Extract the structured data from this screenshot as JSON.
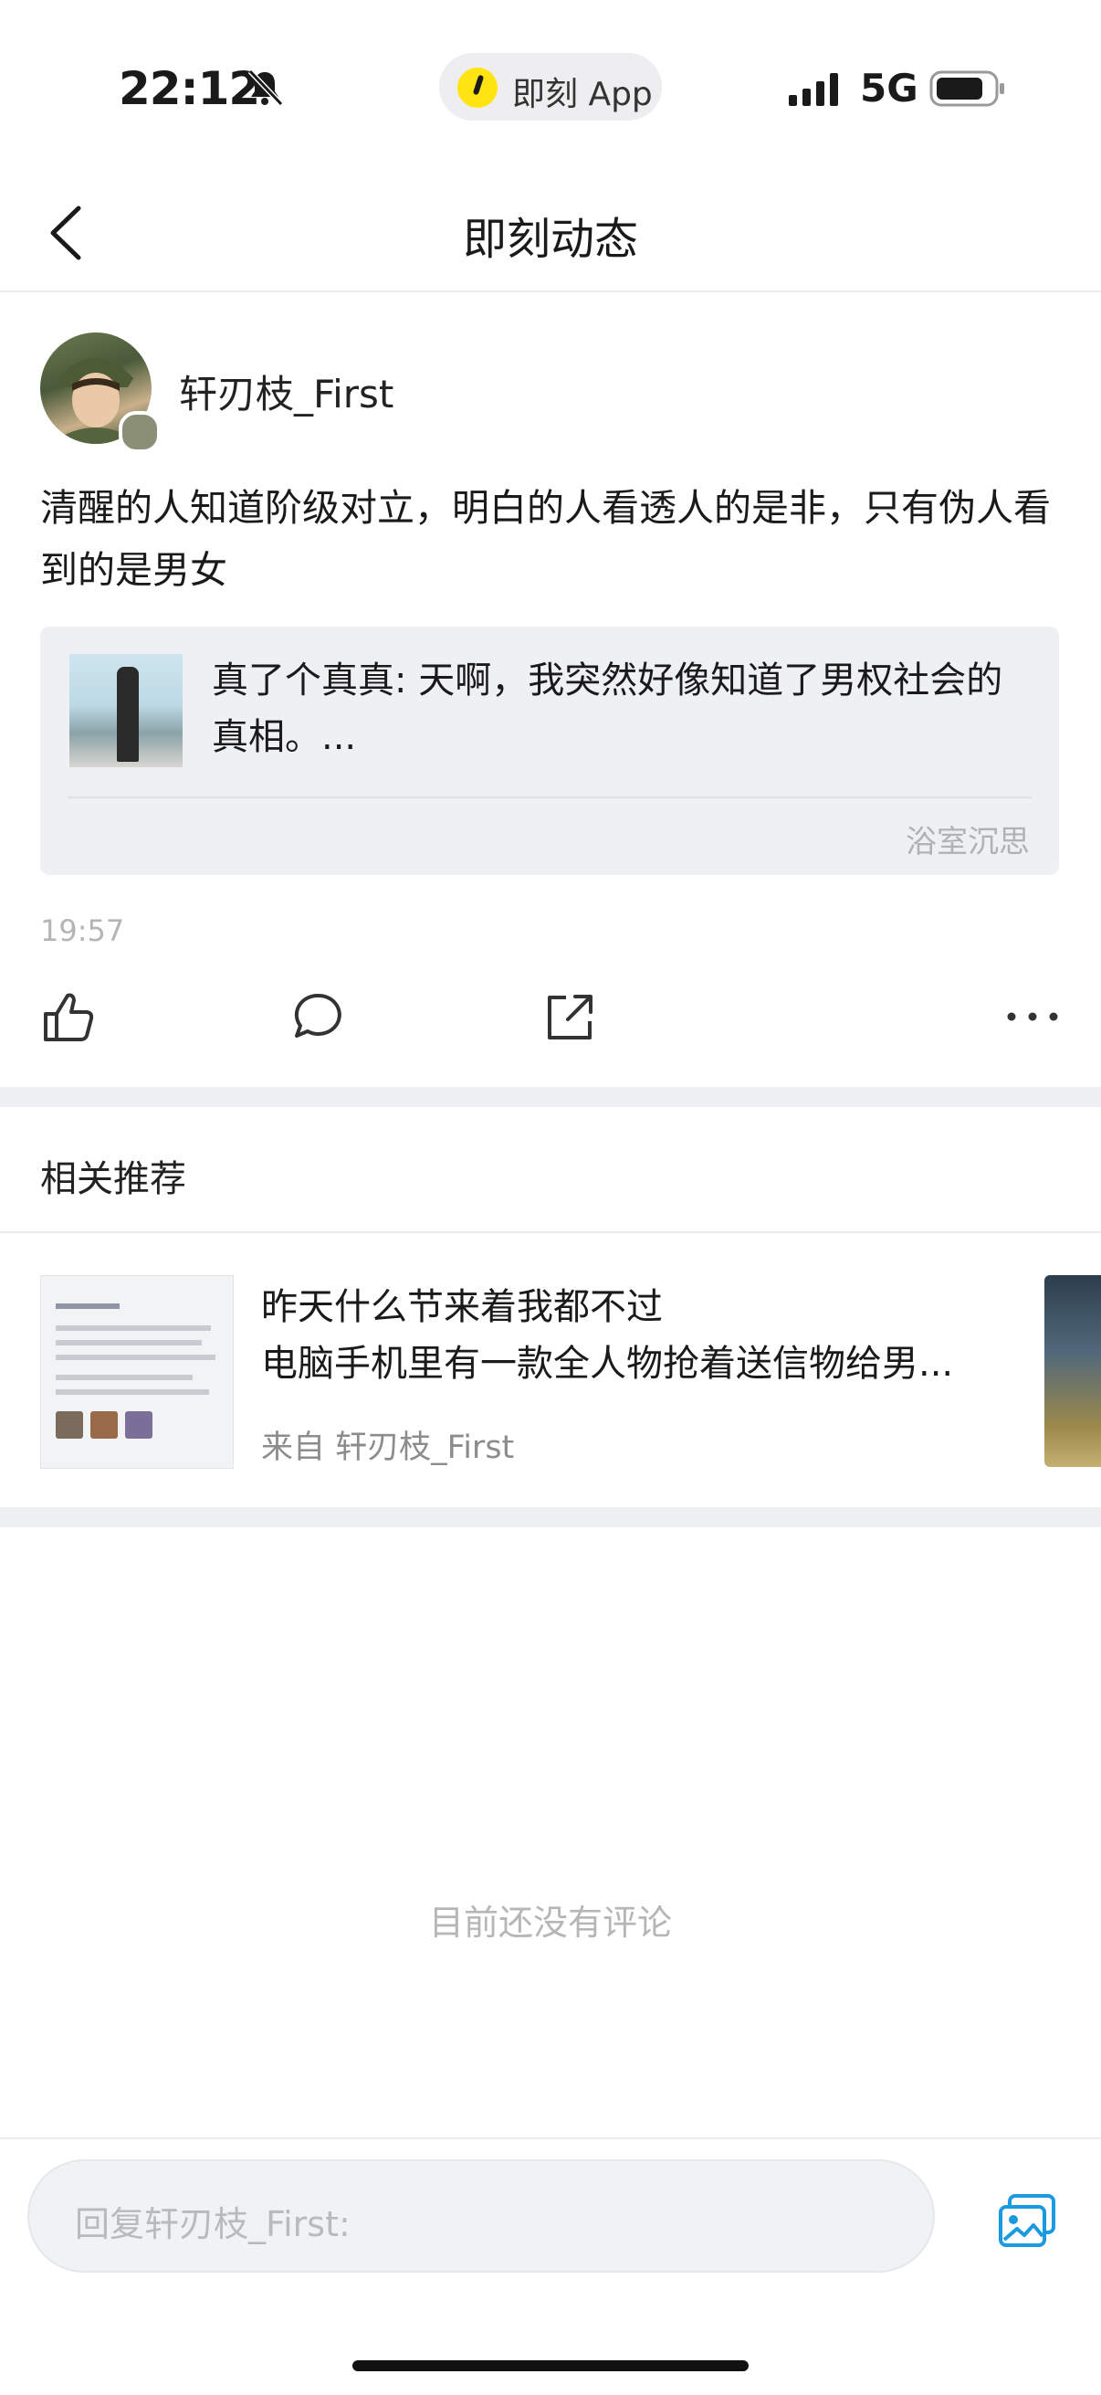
{
  "status_bar": {
    "time": "22:12",
    "app_name": "即刻 App",
    "network": "5G"
  },
  "header": {
    "title": "即刻动态"
  },
  "post": {
    "author": "轩刃枝_First",
    "content": "清醒的人知道阶级对立，明白的人看透人的是非，只有伪人看到的是男女",
    "quote": {
      "text": "真了个真真: 天啊，我突然好像知道了男权社会的真相。...",
      "source": "浴室沉思"
    },
    "time": "19:57"
  },
  "related": {
    "section_title": "相关推荐",
    "items": [
      {
        "title_line1": "昨天什么节来着我都不过",
        "title_line2": "电脑手机里有一款全人物抢着送信物给男...",
        "from": "来自 轩刃枝_First"
      }
    ]
  },
  "comments": {
    "empty_text": "目前还没有评论"
  },
  "reply": {
    "placeholder": "回复轩刃枝_First:"
  },
  "colors": {
    "accent_blue": "#1b9ae0",
    "app_yellow": "#ffe411"
  },
  "icons": [
    "back-icon",
    "like-icon",
    "comment-icon",
    "share-icon",
    "more-icon",
    "image-icon",
    "bell-slash-icon",
    "signal-icon",
    "battery-icon"
  ]
}
